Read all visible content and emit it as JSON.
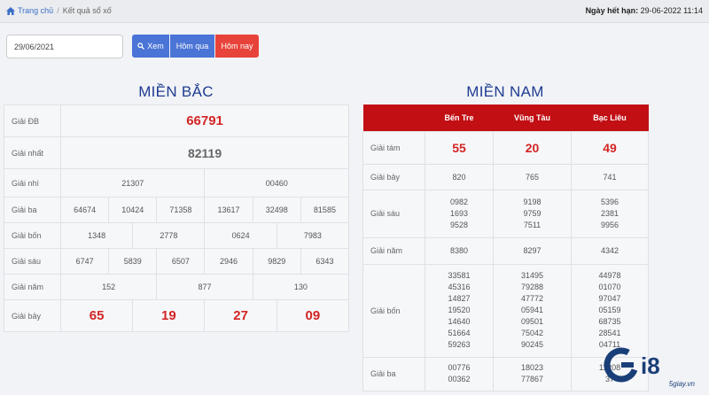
{
  "breadcrumb": {
    "home": "Trang chủ",
    "current": "Kết quả sổ xố"
  },
  "expiry": {
    "label": "Ngày hết hạn:",
    "value": "29-06-2022 11:14"
  },
  "date_input": {
    "value": "29/06/2021"
  },
  "buttons": {
    "view": "Xem",
    "yesterday": "Hôm qua",
    "today": "Hôm nay"
  },
  "icons": {
    "home": "home-icon",
    "search": "search-icon"
  },
  "colors": {
    "accent": "#4a74d6",
    "danger": "#e8433a",
    "header_red": "#c10f14",
    "title_blue": "#1f3c8f"
  },
  "mien_bac": {
    "title": "MIỀN BẮC",
    "rows": [
      {
        "label": "Giải ĐB",
        "values": [
          "66791"
        ]
      },
      {
        "label": "Giải nhất",
        "values": [
          "82119"
        ]
      },
      {
        "label": "Giải nhì",
        "values": [
          "21307",
          "00460"
        ]
      },
      {
        "label": "Giải ba",
        "values": [
          "64674",
          "10424",
          "71358",
          "13617",
          "32498",
          "81585"
        ]
      },
      {
        "label": "Giải bốn",
        "values": [
          "1348",
          "2778",
          "0624",
          "7983"
        ]
      },
      {
        "label": "Giải sáu",
        "values": [
          "6747",
          "5839",
          "6507",
          "2946",
          "9829",
          "6343"
        ]
      },
      {
        "label": "Giải năm",
        "values": [
          "152",
          "877",
          "130"
        ]
      },
      {
        "label": "Giải bảy",
        "values": [
          "65",
          "19",
          "27",
          "09"
        ]
      }
    ]
  },
  "mien_nam": {
    "title": "MIỀN NAM",
    "provinces": [
      "Bến Tre",
      "Vũng Tàu",
      "Bạc Liêu"
    ],
    "rows": [
      {
        "label": "Giải tám",
        "values": [
          "55",
          "20",
          "49"
        ]
      },
      {
        "label": "Giải bảy",
        "values": [
          "820",
          "765",
          "741"
        ]
      },
      {
        "label": "Giải sáu",
        "values": [
          "0982\n1693\n9528",
          "9198\n9759\n7511",
          "5396\n2381\n9956"
        ]
      },
      {
        "label": "Giải năm",
        "values": [
          "8380",
          "8297",
          "4342"
        ]
      },
      {
        "label": "Giải bốn",
        "values": [
          "33581\n45316\n14827\n19520\n14640\n51664\n59263",
          "31495\n79288\n47772\n05941\n09501\n75042\n90245",
          "44978\n01070\n97047\n05159\n68735\n28541\n04711"
        ]
      },
      {
        "label": "Giải ba",
        "values": [
          "00776\n00362",
          "18023\n77867",
          "11208\n37"
        ]
      }
    ]
  },
  "watermark": {
    "logo": "G",
    "suffix": "i8",
    "site": "5giay.vn"
  }
}
